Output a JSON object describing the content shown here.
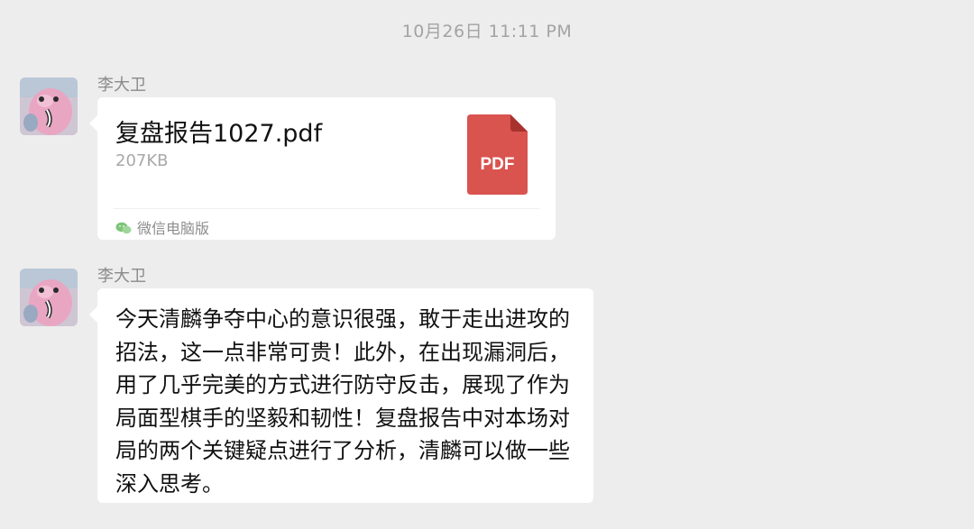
{
  "timestamp": "10月26日 11:11 PM",
  "messages": [
    {
      "sender": "李大卫",
      "type": "file",
      "file": {
        "name": "复盘报告1027.pdf",
        "size": "207KB",
        "icon_label": "PDF",
        "icon_color": "#d9534f",
        "source": "微信电脑版"
      }
    },
    {
      "sender": "李大卫",
      "type": "text",
      "text": "今天清麟争夺中心的意识很强，敢于走出进攻的招法，这一点非常可贵！此外，在出现漏洞后，用了几乎完美的方式进行防守反击，展现了作为局面型棋手的坚毅和韧性！复盘报告中对本场对局的两个关键疑点进行了分析，清麟可以做一些深入思考。"
    }
  ],
  "colors": {
    "background": "#ededed",
    "bubble": "#ffffff",
    "pdf_red": "#d9534f",
    "wechat_green": "#52c41a"
  }
}
